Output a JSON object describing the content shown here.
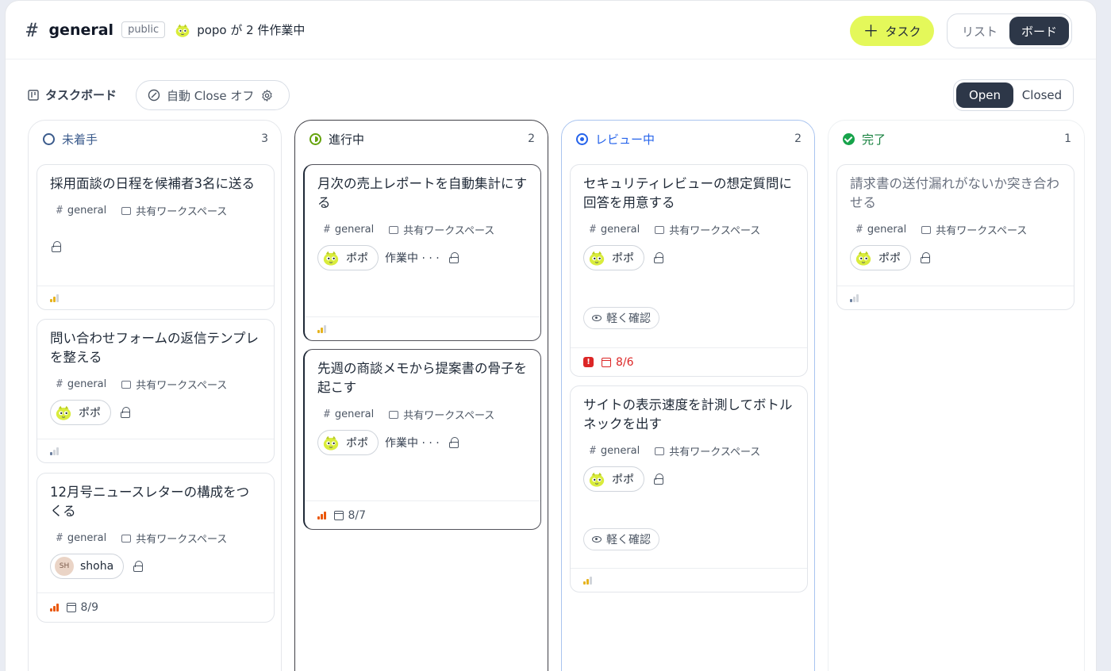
{
  "header": {
    "hash": "#",
    "channel": "general",
    "visibility": "public",
    "status": "popo が 2 件作業中",
    "add_task": "タスク",
    "view_list": "リスト",
    "view_board": "ボード"
  },
  "toolbar": {
    "board_title": "タスクボード",
    "auto_close": "自動 Close オフ",
    "open": "Open",
    "closed": "Closed"
  },
  "columns": [
    {
      "title": "未着手",
      "count": "3",
      "cards": [
        {
          "title": "採用面談の日程を候補者3名に送る",
          "tag": "general",
          "workspace": "共有ワークスペース",
          "priority": "mid"
        },
        {
          "title": "問い合わせフォームの返信テンプレを整える",
          "tag": "general",
          "workspace": "共有ワークスペース",
          "assignee": "ポポ",
          "priority": "low"
        },
        {
          "title": "12月号ニュースレターの構成をつくる",
          "tag": "general",
          "workspace": "共有ワークスペース",
          "assignee": "shoha",
          "avatar_initials": "SH",
          "due": "8/9",
          "priority": "high"
        }
      ]
    },
    {
      "title": "進行中",
      "count": "2",
      "cards": [
        {
          "title": "月次の売上レポートを自動集計にする",
          "tag": "general",
          "workspace": "共有ワークスペース",
          "assignee": "ポポ",
          "working": "作業中 · · ·",
          "priority": "mid"
        },
        {
          "title": "先週の商談メモから提案書の骨子を起こす",
          "tag": "general",
          "workspace": "共有ワークスペース",
          "assignee": "ポポ",
          "working": "作業中 · · ·",
          "due": "8/7",
          "priority": "high"
        }
      ]
    },
    {
      "title": "レビュー中",
      "count": "2",
      "cards": [
        {
          "title": "セキュリティレビューの想定質問に回答を用意する",
          "tag": "general",
          "workspace": "共有ワークスペース",
          "assignee": "ポポ",
          "review": "軽く確認",
          "due": "8/6"
        },
        {
          "title": "サイトの表示速度を計測してボトルネックを出す",
          "tag": "general",
          "workspace": "共有ワークスペース",
          "assignee": "ポポ",
          "review": "軽く確認",
          "priority": "mid"
        }
      ]
    },
    {
      "title": "完了",
      "count": "1",
      "cards": [
        {
          "title": "請求書の送付漏れがないか突き合わせる",
          "tag": "general",
          "workspace": "共有ワークスペース",
          "assignee": "ポポ",
          "priority": "low"
        }
      ]
    }
  ],
  "colors": {
    "accent": "#e4f85a",
    "dark": "#2d3748",
    "overdue": "#dc2626",
    "priority_high": "#ea580c",
    "priority_mid": "#e6b31e"
  }
}
